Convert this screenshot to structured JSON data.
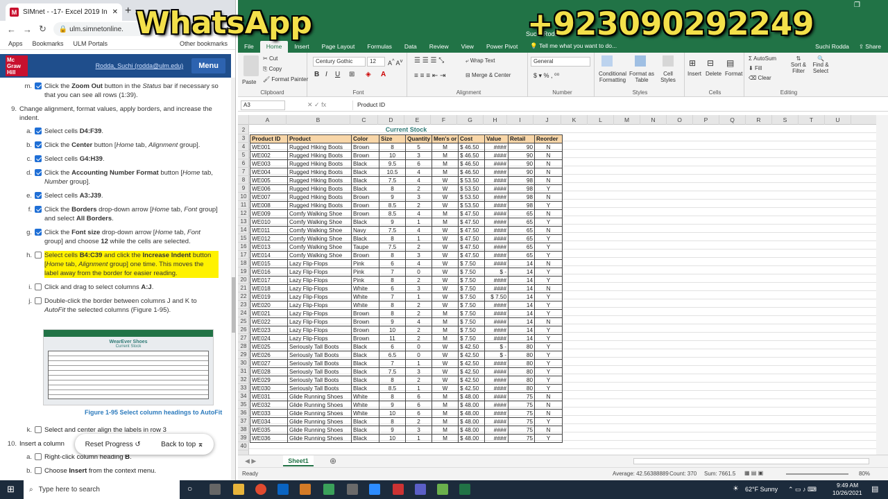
{
  "overlay": {
    "whatsapp": "WhatsApp",
    "phone": "+923090292249"
  },
  "browser": {
    "tab_title": "SIMnet - -17- Excel 2019 In Prac",
    "url": "ulm.simnetonline.",
    "bookmarks": [
      "Apps",
      "Bookmarks",
      "ULM Portals",
      "Other bookmarks"
    ],
    "logo": "Mc Graw Hill",
    "user": "Rodda, Suchi (rodda@ulm.edu)",
    "menu": "Menu",
    "thumb_title": "WearEver Shoes",
    "thumb_sub": "Current Stock",
    "caption": "Figure 1-95 Select column headings to AutoFit",
    "reset": "Reset Progress",
    "back": "Back to top"
  },
  "steps": [
    {
      "kind": "sub",
      "letter": "m.",
      "checked": true,
      "html": "Click the <b>Zoom Out</b> button in the <i>Status</i> bar if necessary so that you can see all rows (1:39)."
    },
    {
      "kind": "num",
      "letter": "9.",
      "html": "Change alignment, format values, apply borders, and increase the indent."
    },
    {
      "kind": "sub",
      "letter": "a.",
      "checked": true,
      "html": "Select cells <b>D4:F39</b>."
    },
    {
      "kind": "sub",
      "letter": "b.",
      "checked": true,
      "html": "Click the <b>Center</b> button [<i>Home</i> tab, <i>Alignment</i> group]."
    },
    {
      "kind": "sub",
      "letter": "c.",
      "checked": true,
      "html": "Select cells <b>G4:H39</b>."
    },
    {
      "kind": "sub",
      "letter": "d.",
      "checked": true,
      "html": "Click the <b>Accounting Number Format</b> button [<i>Home</i> tab, <i>Number</i> group]."
    },
    {
      "kind": "sub",
      "letter": "e.",
      "checked": true,
      "html": "Select cells <b>A3:J39</b>."
    },
    {
      "kind": "sub",
      "letter": "f.",
      "checked": true,
      "html": "Click the <b>Borders</b> drop-down arrow [<i>Home</i> tab, <i>Font</i> group] and select <b>All Borders</b>."
    },
    {
      "kind": "sub",
      "letter": "g.",
      "checked": true,
      "html": "Click the <b>Font size</b> drop-down arrow [<i>Home</i> tab, <i>Font</i> group] and choose <b>12</b> while the cells are selected."
    },
    {
      "kind": "sub",
      "letter": "h.",
      "checked": false,
      "highlight": true,
      "html": "Select cells <b>B4:C39</b> and click the <b>Increase Indent</b> button [<i>Home</i> tab, <i>Alignment</i> group] one time. This moves the label away from the border for easier reading."
    },
    {
      "kind": "sub",
      "letter": "i.",
      "checked": false,
      "html": "Click and drag to select columns <b>A:J</b>."
    },
    {
      "kind": "sub",
      "letter": "j.",
      "checked": false,
      "html": "Double-click the border between columns J and K to <i>AutoFit</i> the selected columns (Figure 1-95)."
    }
  ],
  "steps_after": [
    {
      "kind": "sub",
      "letter": "k.",
      "checked": false,
      "html": "Select and center align the labels in row 3"
    },
    {
      "kind": "num",
      "letter": "10.",
      "html": "Insert a column"
    },
    {
      "kind": "sub",
      "letter": "a.",
      "checked": false,
      "html": "Right-click column heading <b>B</b>."
    },
    {
      "kind": "sub",
      "letter": "b.",
      "checked": false,
      "html": "Choose <b>Insert</b> from the context menu."
    }
  ],
  "excel": {
    "title": "Suchi Rodda",
    "tabs": [
      "File",
      "Home",
      "Insert",
      "Page Layout",
      "Formulas",
      "Data",
      "Review",
      "View",
      "Power Pivot"
    ],
    "tell_me": "Tell me what you want to do...",
    "user": "Suchi Rodda",
    "share": "Share",
    "ribbon": {
      "cut": "Cut",
      "copy": "Copy",
      "format_painter": "Format Painter",
      "paste": "Paste",
      "clipboard": "Clipboard",
      "font": "Century Gothic",
      "size": "12",
      "font_label": "Font",
      "wrap": "Wrap Text",
      "merge": "Merge & Center",
      "alignment": "Alignment",
      "numfmt": "General",
      "number": "Number",
      "cond": "Conditional Formatting",
      "fmt_table": "Format as Table",
      "cell_styles": "Cell Styles",
      "styles": "Styles",
      "insert": "Insert",
      "delete": "Delete",
      "format": "Format",
      "cells": "Cells",
      "autosum": "AutoSum",
      "fill": "Fill",
      "clear": "Clear",
      "sort": "Sort & Filter",
      "find": "Find & Select",
      "editing": "Editing"
    },
    "namebox": "A3",
    "formula": "Product ID",
    "columns": [
      "A",
      "B",
      "C",
      "D",
      "E",
      "F",
      "G",
      "H",
      "I",
      "J",
      "K",
      "L",
      "M",
      "N",
      "O",
      "P",
      "Q",
      "R",
      "S",
      "T",
      "U"
    ],
    "sheet_title": "Current Stock",
    "headers": [
      "Product ID",
      "Product",
      "Color",
      "Size",
      "Quantity",
      "Men's or",
      "Cost",
      "Value",
      "Retail",
      "Reorder"
    ],
    "rows": [
      [
        "WE001",
        "Rugged Hiking Boots",
        "Brown",
        "8",
        "5",
        "M",
        "$ 46.50",
        "####",
        "90",
        "N"
      ],
      [
        "WE002",
        "Rugged Hiking Boots",
        "Brown",
        "10",
        "3",
        "M",
        "$ 46.50",
        "####",
        "90",
        "N"
      ],
      [
        "WE003",
        "Rugged Hiking Boots",
        "Black",
        "9.5",
        "6",
        "M",
        "$ 46.50",
        "####",
        "90",
        "N"
      ],
      [
        "WE004",
        "Rugged Hiking Boots",
        "Black",
        "10.5",
        "4",
        "M",
        "$ 46.50",
        "####",
        "90",
        "N"
      ],
      [
        "WE005",
        "Rugged Hiking Boots",
        "Black",
        "7.5",
        "4",
        "W",
        "$ 53.50",
        "####",
        "98",
        "N"
      ],
      [
        "WE006",
        "Rugged Hiking Boots",
        "Black",
        "8",
        "2",
        "W",
        "$ 53.50",
        "####",
        "98",
        "Y"
      ],
      [
        "WE007",
        "Rugged Hiking Boots",
        "Brown",
        "9",
        "3",
        "W",
        "$ 53.50",
        "####",
        "98",
        "N"
      ],
      [
        "WE008",
        "Rugged Hiking Boots",
        "Brown",
        "8.5",
        "2",
        "W",
        "$ 53.50",
        "####",
        "98",
        "Y"
      ],
      [
        "WE009",
        "Comfy Walking Shoe",
        "Brown",
        "8.5",
        "4",
        "M",
        "$ 47.50",
        "####",
        "65",
        "N"
      ],
      [
        "WE010",
        "Comfy Walking Shoe",
        "Black",
        "9",
        "1",
        "M",
        "$ 47.50",
        "####",
        "65",
        "Y"
      ],
      [
        "WE011",
        "Comfy Walking Shoe",
        "Navy",
        "7.5",
        "4",
        "W",
        "$ 47.50",
        "####",
        "65",
        "N"
      ],
      [
        "WE012",
        "Comfy Walking Shoe",
        "Black",
        "8",
        "1",
        "W",
        "$ 47.50",
        "####",
        "65",
        "Y"
      ],
      [
        "WE013",
        "Comfy Walking Shoe",
        "Taupe",
        "7.5",
        "2",
        "W",
        "$ 47.50",
        "####",
        "65",
        "Y"
      ],
      [
        "WE014",
        "Comfy Walking Shoe",
        "Brown",
        "8",
        "3",
        "W",
        "$ 47.50",
        "####",
        "65",
        "Y"
      ],
      [
        "WE015",
        "Lazy Flip-Flops",
        "Pink",
        "6",
        "4",
        "W",
        "$ 7.50",
        "####",
        "14",
        "N"
      ],
      [
        "WE016",
        "Lazy Flip-Flops",
        "Pink",
        "7",
        "0",
        "W",
        "$ 7.50",
        "$ -",
        "14",
        "Y"
      ],
      [
        "WE017",
        "Lazy Flip-Flops",
        "Pink",
        "8",
        "2",
        "W",
        "$ 7.50",
        "####",
        "14",
        "Y"
      ],
      [
        "WE018",
        "Lazy Flip-Flops",
        "White",
        "6",
        "3",
        "W",
        "$ 7.50",
        "####",
        "14",
        "N"
      ],
      [
        "WE019",
        "Lazy Flip-Flops",
        "White",
        "7",
        "1",
        "W",
        "$ 7.50",
        "$ 7.50",
        "14",
        "Y"
      ],
      [
        "WE020",
        "Lazy Flip-Flops",
        "White",
        "8",
        "2",
        "W",
        "$ 7.50",
        "####",
        "14",
        "Y"
      ],
      [
        "WE021",
        "Lazy Flip-Flops",
        "Brown",
        "8",
        "2",
        "M",
        "$ 7.50",
        "####",
        "14",
        "Y"
      ],
      [
        "WE022",
        "Lazy Flip-Flops",
        "Brown",
        "9",
        "4",
        "M",
        "$ 7.50",
        "####",
        "14",
        "N"
      ],
      [
        "WE023",
        "Lazy Flip-Flops",
        "Brown",
        "10",
        "2",
        "M",
        "$ 7.50",
        "####",
        "14",
        "Y"
      ],
      [
        "WE024",
        "Lazy Flip-Flops",
        "Brown",
        "11",
        "2",
        "M",
        "$ 7.50",
        "####",
        "14",
        "Y"
      ],
      [
        "WE025",
        "Seriously Tall Boots",
        "Black",
        "6",
        "0",
        "W",
        "$ 42.50",
        "$ -",
        "80",
        "Y"
      ],
      [
        "WE026",
        "Seriously Tall Boots",
        "Black",
        "6.5",
        "0",
        "W",
        "$ 42.50",
        "$ -",
        "80",
        "Y"
      ],
      [
        "WE027",
        "Seriously Tall Boots",
        "Black",
        "7",
        "1",
        "W",
        "$ 42.50",
        "####",
        "80",
        "Y"
      ],
      [
        "WE028",
        "Seriously Tall Boots",
        "Black",
        "7.5",
        "3",
        "W",
        "$ 42.50",
        "####",
        "80",
        "Y"
      ],
      [
        "WE029",
        "Seriously Tall Boots",
        "Black",
        "8",
        "2",
        "W",
        "$ 42.50",
        "####",
        "80",
        "Y"
      ],
      [
        "WE030",
        "Seriously Tall Boots",
        "Black",
        "8.5",
        "1",
        "W",
        "$ 42.50",
        "####",
        "80",
        "Y"
      ],
      [
        "WE031",
        "Glide Running Shoes",
        "White",
        "8",
        "6",
        "M",
        "$ 48.00",
        "####",
        "75",
        "N"
      ],
      [
        "WE032",
        "Glide Running Shoes",
        "White",
        "9",
        "6",
        "M",
        "$ 48.00",
        "####",
        "75",
        "N"
      ],
      [
        "WE033",
        "Glide Running Shoes",
        "White",
        "10",
        "6",
        "M",
        "$ 48.00",
        "####",
        "75",
        "N"
      ],
      [
        "WE034",
        "Glide Running Shoes",
        "Black",
        "8",
        "2",
        "M",
        "$ 48.00",
        "####",
        "75",
        "Y"
      ],
      [
        "WE035",
        "Glide Running Shoes",
        "Black",
        "9",
        "3",
        "M",
        "$ 48.00",
        "####",
        "75",
        "N"
      ],
      [
        "WE036",
        "Glide Running Shoes",
        "Black",
        "10",
        "1",
        "M",
        "$ 48.00",
        "####",
        "75",
        "Y"
      ]
    ],
    "sheet_tab": "Sheet1",
    "status": {
      "ready": "Ready",
      "average": "Average: 42.56388889",
      "count": "Count: 370",
      "sum": "Sum: 7661.5",
      "zoom": "80%"
    }
  },
  "taskbar": {
    "search": "Type here to search",
    "weather": "62°F  Sunny",
    "time": "9:49 AM",
    "date": "10/26/2021"
  }
}
